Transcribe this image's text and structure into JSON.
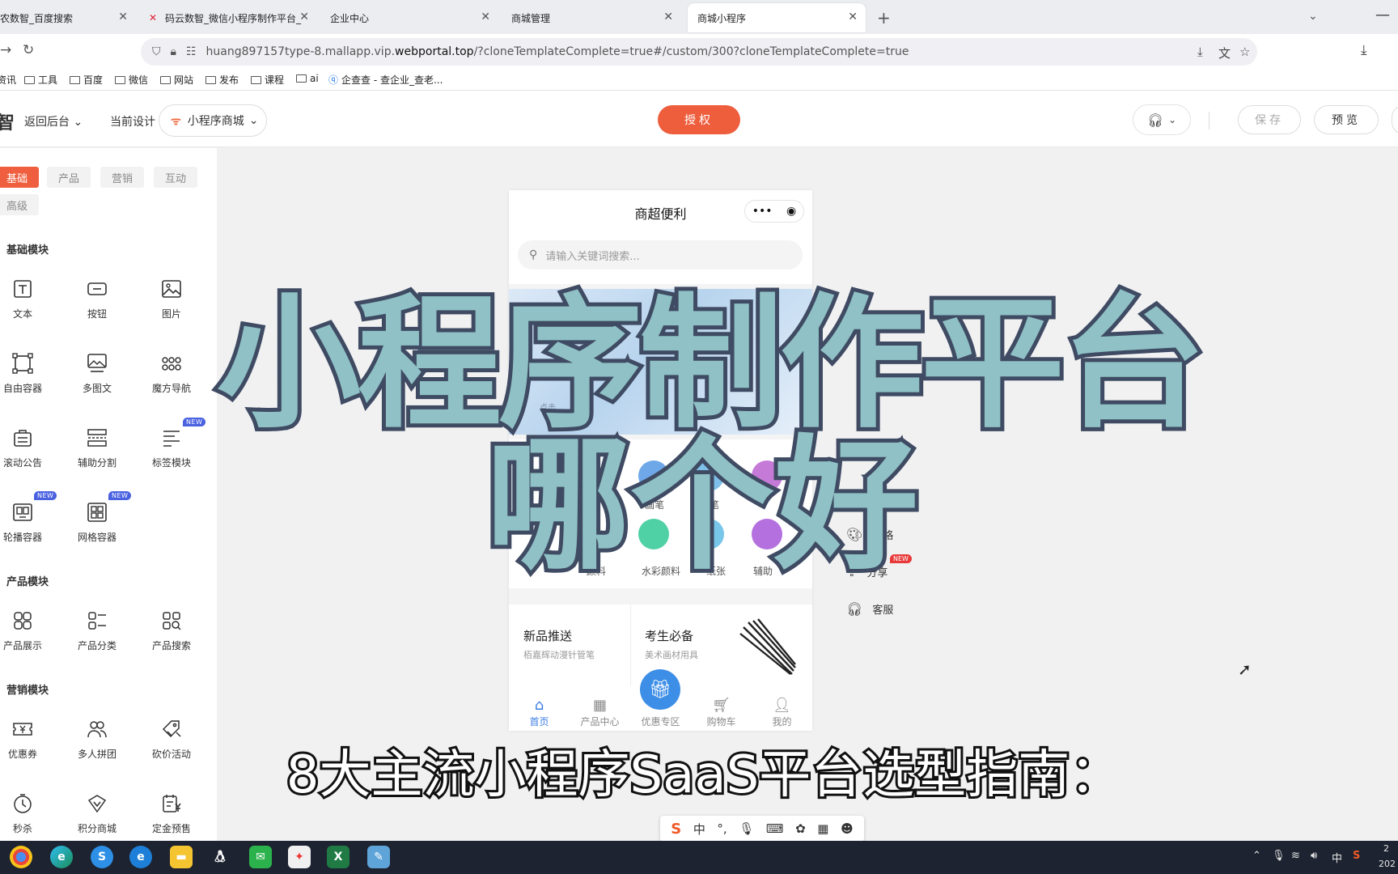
{
  "browser": {
    "tabs": [
      {
        "label": "农数智_百度搜索",
        "active": false
      },
      {
        "label": "码云数智_微信小程序制作平台_",
        "active": false
      },
      {
        "label": "企业中心",
        "active": false
      },
      {
        "label": "商城管理",
        "active": false
      },
      {
        "label": "商城小程序",
        "active": true
      }
    ],
    "url_prefix": "huang897157type-8.mallapp.vip.",
    "url_host": "webportal.top",
    "url_rest": "/?cloneTemplateComplete=true#/custom/300?cloneTemplateComplete=true",
    "bookmarks": [
      "资讯",
      "工具",
      "百度",
      "微信",
      "网站",
      "发布",
      "课程",
      "ai",
      "企查查 - 查企业_查老..."
    ]
  },
  "header": {
    "logo_fragment": "智",
    "back_label": "返回后台",
    "current_design_label": "当前设计",
    "current_design_value": "小程序商城",
    "authorize_label": "授权",
    "save_label": "保存",
    "preview_label": "预览"
  },
  "left_panel": {
    "category_tabs": [
      "基础",
      "产品",
      "营销",
      "互动",
      "高级"
    ],
    "sections": [
      {
        "title": "基础模块",
        "items": [
          {
            "label": "文本",
            "icon": "text-icon"
          },
          {
            "label": "按钮",
            "icon": "button-icon"
          },
          {
            "label": "图片",
            "icon": "image-icon"
          },
          {
            "label": "自由容器",
            "icon": "free-container-icon"
          },
          {
            "label": "多图文",
            "icon": "multi-image-text-icon"
          },
          {
            "label": "魔方导航",
            "icon": "cube-nav-icon"
          },
          {
            "label": "滚动公告",
            "icon": "scroll-notice-icon"
          },
          {
            "label": "辅助分割",
            "icon": "divider-icon"
          },
          {
            "label": "标签模块",
            "icon": "tag-module-icon",
            "badge": "NEW"
          },
          {
            "label": "轮播容器",
            "icon": "carousel-container-icon",
            "badge": "NEW"
          },
          {
            "label": "网格容器",
            "icon": "grid-container-icon",
            "badge": "NEW"
          }
        ]
      },
      {
        "title": "产品模块",
        "items": [
          {
            "label": "产品展示",
            "icon": "product-display-icon"
          },
          {
            "label": "产品分类",
            "icon": "product-category-icon"
          },
          {
            "label": "产品搜索",
            "icon": "product-search-icon"
          }
        ]
      },
      {
        "title": "营销模块",
        "items": [
          {
            "label": "优惠券",
            "icon": "coupon-icon"
          },
          {
            "label": "多人拼团",
            "icon": "group-buy-icon"
          },
          {
            "label": "砍价活动",
            "icon": "bargain-icon"
          },
          {
            "label": "秒杀",
            "icon": "flash-sale-icon"
          },
          {
            "label": "积分商城",
            "icon": "points-mall-icon"
          },
          {
            "label": "定金预售",
            "icon": "presale-icon"
          }
        ]
      }
    ]
  },
  "phone": {
    "title": "商超便利",
    "search_placeholder": "请输入关键词搜索...",
    "banner_text": "点击",
    "icon_row1": [
      "画笔",
      "炭笔"
    ],
    "icon_row2": [
      "颜料",
      "水彩颜料",
      "纸张",
      "辅助"
    ],
    "promo": [
      {
        "title": "新品推送",
        "subtitle": "栢嘉辉动漫针管笔"
      },
      {
        "title": "考生必备",
        "subtitle": "美术画材用具"
      }
    ],
    "tabbar": [
      {
        "label": "首页",
        "icon": "home-icon",
        "active": true
      },
      {
        "label": "产品中心",
        "icon": "grid-icon",
        "active": false
      },
      {
        "label": "优惠专区",
        "icon": "gift-icon",
        "active": false
      },
      {
        "label": "购物车",
        "icon": "cart-icon",
        "active": false
      },
      {
        "label": "我的",
        "icon": "user-icon",
        "active": false
      }
    ]
  },
  "side_actions": [
    {
      "label": "风格",
      "icon": "style-icon"
    },
    {
      "label": "分享",
      "icon": "share-icon",
      "badge": "NEW"
    },
    {
      "label": "客服",
      "icon": "headset-icon"
    }
  ],
  "overlay": {
    "title_line1": "小程序制作平台",
    "title_line2": "哪个好",
    "subtitle": "8大主流小程序SaaS平台选型指南："
  },
  "ime": {
    "mode": "中"
  },
  "taskbar": {
    "tray_lang": "中",
    "time_fragment": "2",
    "date_fragment": "202"
  },
  "colors": {
    "accent": "#ee5e3d",
    "phone_active": "#3d7de3",
    "overlay_fill": "#8fc1c6",
    "overlay_stroke": "#3f4b63",
    "new_badge_blue": "#4a62e0",
    "new_badge_red": "#e83a3a"
  }
}
